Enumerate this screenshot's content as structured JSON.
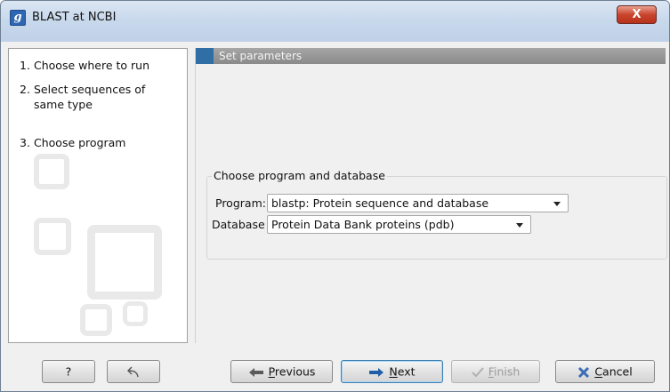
{
  "window": {
    "app_icon_letter": "g",
    "title": "BLAST at NCBI",
    "close_glyph": "X"
  },
  "steps": [
    {
      "num": "1.",
      "label": "Choose where to run"
    },
    {
      "num": "2.",
      "label": "Select sequences of same type"
    },
    {
      "num": "3.",
      "label": "Choose program"
    }
  ],
  "section": {
    "title": "Set parameters"
  },
  "group": {
    "title": "Choose program and database",
    "program_label": "Program:",
    "program_value": "blastp: Protein sequence and database",
    "database_label": "Database",
    "database_value": "Protein Data Bank proteins (pdb)"
  },
  "buttons": {
    "help": "?",
    "reset_icon": "undo-arrow-icon",
    "previous": {
      "first": "P",
      "rest": "revious"
    },
    "next": {
      "first": "N",
      "rest": "ext"
    },
    "finish": {
      "first": "F",
      "rest": "inish"
    },
    "cancel": {
      "first": "C",
      "rest": "ancel"
    }
  },
  "colors": {
    "accent": "#2f6fa6",
    "header_gray": "#8a8a8a",
    "next_arrow": "#1f5fa8",
    "cancel_x": "#3a6db5"
  }
}
